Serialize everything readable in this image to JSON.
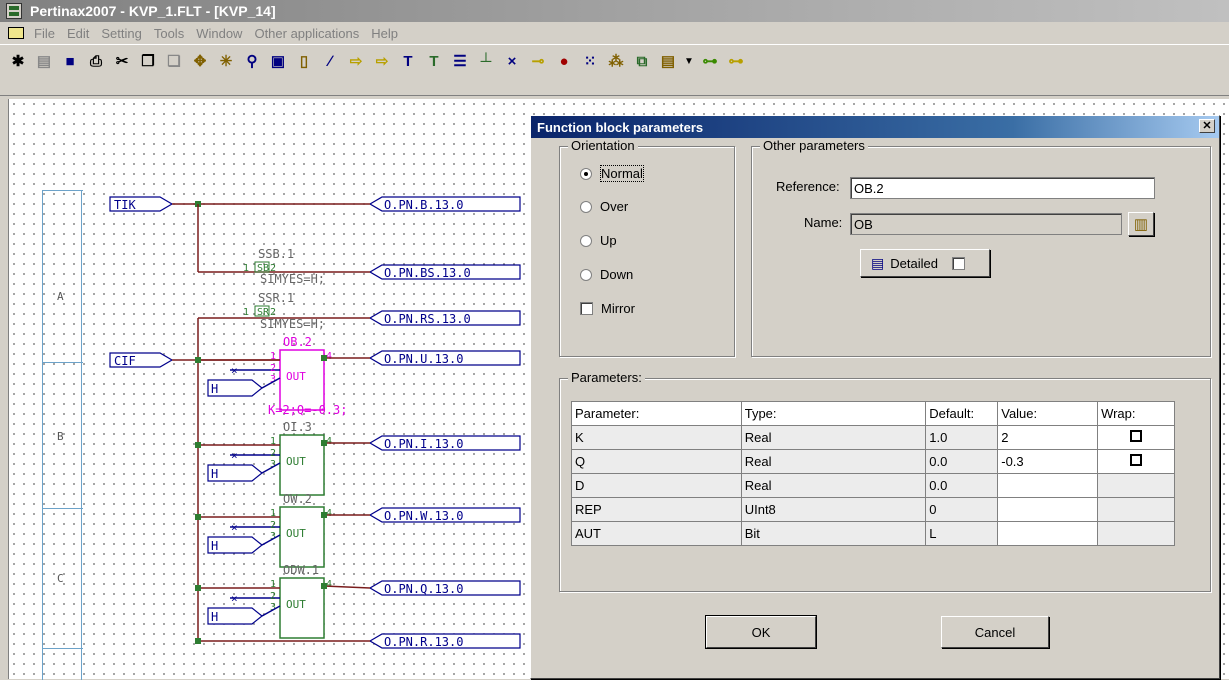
{
  "window": {
    "title": "Pertinax2007 - KVP_1.FLT - [KVP_14]"
  },
  "menu": [
    "File",
    "Edit",
    "Setting",
    "Tools",
    "Window",
    "Other applications",
    "Help"
  ],
  "diagram": {
    "zones": [
      "A",
      "B",
      "C"
    ],
    "inputs": [
      "TIK",
      "CIF"
    ],
    "outputs": [
      "O.PN.B.13.0",
      "O.PN.BS.13.0",
      "O.PN.RS.13.0",
      "O.PN.U.13.0",
      "O.PN.I.13.0",
      "O.PN.W.13.0",
      "O.PN.Q.13.0",
      "O.PN.R.13.0"
    ],
    "sb_block": {
      "name": "SSB.1",
      "type": "SB",
      "params": "SIMYES=H;"
    },
    "sr_block": {
      "name": "SSR.1",
      "type": "SR",
      "params": "SIMYES=H;"
    },
    "blocks": [
      {
        "name": "OB.2",
        "params": "K=2;Q=-0.3;",
        "out": "OUT"
      },
      {
        "name": "OI.3",
        "params": "",
        "out": "OUT"
      },
      {
        "name": "OW.2",
        "params": "",
        "out": "OUT"
      },
      {
        "name": "ODW.1",
        "params": "",
        "out": "OUT"
      }
    ],
    "h_label": "H",
    "pins": {
      "p1": "1",
      "p2": "2",
      "p3": "3",
      "p4": "4"
    }
  },
  "dialog": {
    "title": "Function block parameters",
    "orientation": {
      "label": "Orientation",
      "options": [
        "Normal",
        "Over",
        "Up",
        "Down"
      ],
      "selected": "Normal",
      "mirror": "Mirror"
    },
    "other": {
      "label": "Other parameters",
      "reference_label": "Reference:",
      "reference_value": "OB.2",
      "name_label": "Name:",
      "name_value": "OB",
      "detailed": "Detailed"
    },
    "params": {
      "label": "Parameters:",
      "columns": [
        "Parameter:",
        "Type:",
        "Default:",
        "Value:",
        "Wrap:"
      ],
      "rows": [
        {
          "param": "K",
          "type": "Real",
          "default": "1.0",
          "value": "2",
          "wrap": true
        },
        {
          "param": "Q",
          "type": "Real",
          "default": "0.0",
          "value": "-0.3",
          "wrap": true
        },
        {
          "param": "D",
          "type": "Real",
          "default": "0.0",
          "value": "",
          "wrap": false
        },
        {
          "param": "REP",
          "type": "UInt8",
          "default": "0",
          "value": "",
          "wrap": false
        },
        {
          "param": "AUT",
          "type": "Bit",
          "default": "L",
          "value": "",
          "wrap": false
        }
      ]
    },
    "ok": "OK",
    "cancel": "Cancel"
  }
}
